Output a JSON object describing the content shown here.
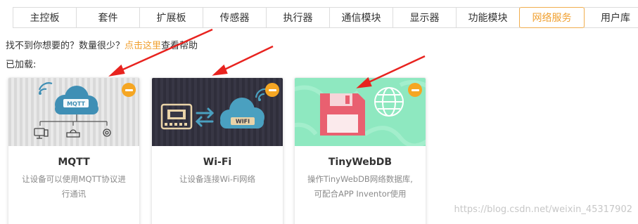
{
  "tabs": [
    {
      "label": "主控板",
      "active": false
    },
    {
      "label": "套件",
      "active": false
    },
    {
      "label": "扩展板",
      "active": false
    },
    {
      "label": "传感器",
      "active": false
    },
    {
      "label": "执行器",
      "active": false
    },
    {
      "label": "通信模块",
      "active": false
    },
    {
      "label": "显示器",
      "active": false
    },
    {
      "label": "功能模块",
      "active": false
    },
    {
      "label": "网络服务",
      "active": true
    },
    {
      "label": "用户库",
      "active": false
    }
  ],
  "hint": {
    "before": "找不到你想要的？数量很少？",
    "link": "点击这里",
    "after": "查看帮助"
  },
  "loaded_label": "已加载:",
  "cards": [
    {
      "title": "MQTT",
      "desc": "让设备可以使用MQTT协议进行通讯",
      "banner_text": "MQTT",
      "icon": "mqtt-cloud-icon"
    },
    {
      "title": "Wi-Fi",
      "desc": "让设备连接Wi-Fi网络",
      "banner_text": "WIFI",
      "icon": "wifi-cloud-icon"
    },
    {
      "title": "TinyWebDB",
      "desc": "操作TinyWebDB网络数据库,可配合APP Inventor使用",
      "icon": "floppy-disk-icon"
    }
  ],
  "watermark": "https://blog.csdn.net/weixin_45317902",
  "colors": {
    "accent": "#f0a030",
    "remove_badge": "#f5a623",
    "arrow": "#e8231f"
  }
}
